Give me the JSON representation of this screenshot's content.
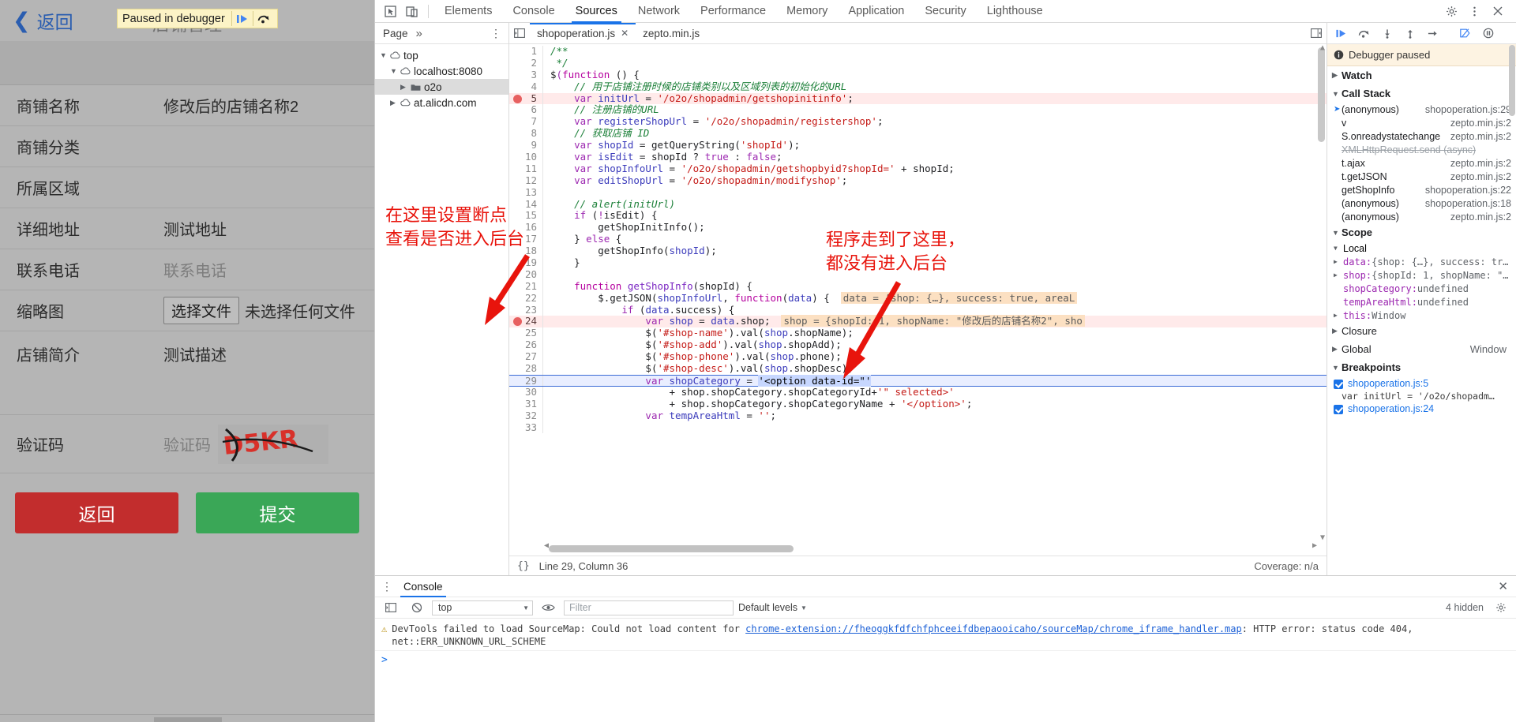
{
  "mobile_page": {
    "back_label": "返回",
    "ghost_title": "店铺管理",
    "paused_banner": {
      "text": "Paused in debugger",
      "resume_icon": "resume-script-icon",
      "step-over_icon": "step-over-icon"
    },
    "fields": [
      {
        "label": "商铺名称",
        "value": "修改后的店铺名称2",
        "placeholder": ""
      },
      {
        "label": "商铺分类",
        "value": "",
        "placeholder": ""
      },
      {
        "label": "所属区域",
        "value": "",
        "placeholder": ""
      },
      {
        "label": "详细地址",
        "value": "测试地址",
        "placeholder": ""
      },
      {
        "label": "联系电话",
        "value": "",
        "placeholder": "联系电话"
      }
    ],
    "thumbnail": {
      "label": "缩略图",
      "button": "选择文件",
      "status": "未选择任何文件"
    },
    "intro": {
      "label": "店铺简介",
      "value": "测试描述"
    },
    "captcha": {
      "label": "验证码",
      "placeholder": "验证码",
      "image_text": "D5KR"
    },
    "buttons": {
      "back": "返回",
      "submit": "提交"
    }
  },
  "devtools": {
    "tabs": [
      "Elements",
      "Console",
      "Sources",
      "Network",
      "Performance",
      "Memory",
      "Application",
      "Security",
      "Lighthouse"
    ],
    "active_tab": "Sources",
    "toolbar_icons": [
      "inspect-element-icon",
      "device-toolbar-icon"
    ],
    "toolbar_right_icons": [
      "settings-gear-icon",
      "more-vertical-icon",
      "close-devtools-icon"
    ],
    "nav": {
      "header_title": "Page",
      "header_more": "»",
      "header_dots": "⋮",
      "tree": [
        {
          "label": "top",
          "depth": 0,
          "icon": "triangle-down",
          "selected": false
        },
        {
          "label": "localhost:8080",
          "depth": 1,
          "icon": "cloud-icon",
          "selected": false
        },
        {
          "label": "o2o",
          "depth": 2,
          "icon": "folder-icon",
          "selected": true
        },
        {
          "label": "at.alicdn.com",
          "depth": 1,
          "icon": "cloud-icon",
          "selected": false
        }
      ]
    },
    "file_tabs": [
      {
        "label": "shopoperation.js",
        "active": true,
        "closable": true
      },
      {
        "label": "zepto.min.js",
        "active": false,
        "closable": false
      }
    ],
    "code_lines": [
      {
        "n": 1,
        "indent": 0,
        "tokens": [
          [
            "com",
            "/**"
          ]
        ]
      },
      {
        "n": 2,
        "indent": 0,
        "tokens": [
          [
            "com",
            " */"
          ]
        ]
      },
      {
        "n": 3,
        "indent": 0,
        "tokens": [
          [
            "pln",
            "$"
          ],
          [
            "kw",
            "("
          ],
          [
            "kw2",
            "function"
          ],
          [
            "pln",
            " () {"
          ]
        ]
      },
      {
        "n": 4,
        "indent": 1,
        "tokens": [
          [
            "com",
            "// 用于店铺注册时候的店铺类别以及区域列表的初始化的URL"
          ]
        ]
      },
      {
        "n": 5,
        "indent": 1,
        "breakpoint": true,
        "tokens": [
          [
            "kw",
            "var"
          ],
          [
            "pln",
            " "
          ],
          [
            "var",
            "initUrl"
          ],
          [
            "pln",
            " = "
          ],
          [
            "str",
            "'/o2o/shopadmin/getshopinitinfo'"
          ],
          [
            "pln",
            ";"
          ]
        ]
      },
      {
        "n": 6,
        "indent": 1,
        "tokens": [
          [
            "com",
            "// 注册店铺的URL"
          ]
        ]
      },
      {
        "n": 7,
        "indent": 1,
        "tokens": [
          [
            "kw",
            "var"
          ],
          [
            "pln",
            " "
          ],
          [
            "var",
            "registerShopUrl"
          ],
          [
            "pln",
            " = "
          ],
          [
            "str",
            "'/o2o/shopadmin/registershop'"
          ],
          [
            "pln",
            ";"
          ]
        ]
      },
      {
        "n": 8,
        "indent": 1,
        "tokens": [
          [
            "com",
            "// 获取店铺 ID"
          ]
        ]
      },
      {
        "n": 9,
        "indent": 1,
        "tokens": [
          [
            "kw",
            "var"
          ],
          [
            "pln",
            " "
          ],
          [
            "var",
            "shopId"
          ],
          [
            "pln",
            " = getQueryString("
          ],
          [
            "str",
            "'shopId'"
          ],
          [
            "pln",
            ");"
          ]
        ]
      },
      {
        "n": 10,
        "indent": 1,
        "tokens": [
          [
            "kw",
            "var"
          ],
          [
            "pln",
            " "
          ],
          [
            "var",
            "isEdit"
          ],
          [
            "pln",
            " = shopId ? "
          ],
          [
            "kw",
            "true"
          ],
          [
            "pln",
            " : "
          ],
          [
            "kw",
            "false"
          ],
          [
            "pln",
            ";"
          ]
        ]
      },
      {
        "n": 11,
        "indent": 1,
        "tokens": [
          [
            "kw",
            "var"
          ],
          [
            "pln",
            " "
          ],
          [
            "var",
            "shopInfoUrl"
          ],
          [
            "pln",
            " = "
          ],
          [
            "str",
            "'/o2o/shopadmin/getshopbyid?shopId='"
          ],
          [
            "pln",
            " + shopId;"
          ]
        ]
      },
      {
        "n": 12,
        "indent": 1,
        "tokens": [
          [
            "kw",
            "var"
          ],
          [
            "pln",
            " "
          ],
          [
            "var",
            "editShopUrl"
          ],
          [
            "pln",
            " = "
          ],
          [
            "str",
            "'/o2o/shopadmin/modifyshop'"
          ],
          [
            "pln",
            ";"
          ]
        ]
      },
      {
        "n": 13,
        "indent": 0,
        "tokens": [
          [
            "pln",
            ""
          ]
        ]
      },
      {
        "n": 14,
        "indent": 1,
        "tokens": [
          [
            "com",
            "// alert(initUrl)"
          ]
        ]
      },
      {
        "n": 15,
        "indent": 1,
        "tokens": [
          [
            "kw",
            "if"
          ],
          [
            "pln",
            " ("
          ],
          [
            "kw",
            "!"
          ],
          [
            "pln",
            "isEdit) {"
          ]
        ]
      },
      {
        "n": 16,
        "indent": 2,
        "tokens": [
          [
            "pln",
            "getShopInitInfo();"
          ]
        ]
      },
      {
        "n": 17,
        "indent": 1,
        "tokens": [
          [
            "pln",
            "} "
          ],
          [
            "kw",
            "else"
          ],
          [
            "pln",
            " {"
          ]
        ]
      },
      {
        "n": 18,
        "indent": 2,
        "tokens": [
          [
            "pln",
            "getShopInfo("
          ],
          [
            "var",
            "shopId"
          ],
          [
            "pln",
            ");"
          ]
        ]
      },
      {
        "n": 19,
        "indent": 1,
        "tokens": [
          [
            "pln",
            "}"
          ]
        ]
      },
      {
        "n": 20,
        "indent": 0,
        "tokens": [
          [
            "pln",
            ""
          ]
        ]
      },
      {
        "n": 21,
        "indent": 1,
        "tokens": [
          [
            "kw2",
            "function"
          ],
          [
            "pln",
            " "
          ],
          [
            "fn",
            "getShopInfo"
          ],
          [
            "pln",
            "(shopId) {"
          ]
        ]
      },
      {
        "n": 22,
        "indent": 2,
        "tokens": [
          [
            "pln",
            "$.getJSON("
          ],
          [
            "var",
            "shopInfoUrl"
          ],
          [
            "pln",
            ", "
          ],
          [
            "kw2",
            "function"
          ],
          [
            "pln",
            "("
          ],
          [
            "var",
            "data"
          ],
          [
            "pln",
            ") {"
          ]
        ],
        "inline_hint": "data = {shop: {…}, success: true, areaL"
      },
      {
        "n": 23,
        "indent": 3,
        "tokens": [
          [
            "kw",
            "if"
          ],
          [
            "pln",
            " ("
          ],
          [
            "var",
            "data"
          ],
          [
            "pln",
            ".success) {"
          ]
        ]
      },
      {
        "n": 24,
        "indent": 4,
        "breakpoint": true,
        "tokens": [
          [
            "kw",
            "var"
          ],
          [
            "pln",
            " "
          ],
          [
            "var",
            "shop"
          ],
          [
            "pln",
            " = "
          ],
          [
            "var",
            "data"
          ],
          [
            "pln",
            ".shop;"
          ]
        ],
        "inline_hint": "shop = {shopId: 1, shopName: \"修改后的店铺名称2\", sho"
      },
      {
        "n": 25,
        "indent": 4,
        "tokens": [
          [
            "pln",
            "$("
          ],
          [
            "str",
            "'#shop-name'"
          ],
          [
            "pln",
            ").val("
          ],
          [
            "var",
            "shop"
          ],
          [
            "pln",
            ".shopName);"
          ]
        ]
      },
      {
        "n": 26,
        "indent": 4,
        "tokens": [
          [
            "pln",
            "$("
          ],
          [
            "str",
            "'#shop-add'"
          ],
          [
            "pln",
            ").val("
          ],
          [
            "var",
            "shop"
          ],
          [
            "pln",
            ".shopAdd);"
          ]
        ]
      },
      {
        "n": 27,
        "indent": 4,
        "tokens": [
          [
            "pln",
            "$("
          ],
          [
            "str",
            "'#shop-phone'"
          ],
          [
            "pln",
            ").val("
          ],
          [
            "var",
            "shop"
          ],
          [
            "pln",
            ".phone);"
          ]
        ]
      },
      {
        "n": 28,
        "indent": 4,
        "tokens": [
          [
            "pln",
            "$("
          ],
          [
            "str",
            "'#shop-desc'"
          ],
          [
            "pln",
            ").val("
          ],
          [
            "var",
            "shop"
          ],
          [
            "pln",
            ".shopDesc);"
          ]
        ]
      },
      {
        "n": 29,
        "indent": 4,
        "executing": true,
        "tokens": [
          [
            "kw",
            "var"
          ],
          [
            "pln",
            " "
          ],
          [
            "var",
            "shopCategory"
          ],
          [
            "pln",
            " = "
          ],
          [
            "sel-tok",
            "'<option data-id=\"'"
          ]
        ]
      },
      {
        "n": 30,
        "indent": 5,
        "tokens": [
          [
            "pln",
            "+ shop.shopCategory.shopCategoryId+"
          ],
          [
            "str",
            "'\" selected>'"
          ]
        ]
      },
      {
        "n": 31,
        "indent": 5,
        "tokens": [
          [
            "pln",
            "+ shop.shopCategory.shopCategoryName + "
          ],
          [
            "str",
            "'</option>'"
          ],
          [
            "pln",
            ";"
          ]
        ]
      },
      {
        "n": 32,
        "indent": 4,
        "tokens": [
          [
            "kw",
            "var"
          ],
          [
            "pln",
            " "
          ],
          [
            "var",
            "tempAreaHtml"
          ],
          [
            "pln",
            " = "
          ],
          [
            "str",
            "''"
          ],
          [
            "pln",
            ";"
          ]
        ]
      },
      {
        "n": 33,
        "indent": 0,
        "tokens": [
          [
            "pln",
            ""
          ]
        ]
      }
    ],
    "status_bar": {
      "braces": "{}",
      "position": "Line 29, Column 36",
      "coverage": "Coverage: n/a"
    },
    "debugger": {
      "toolbar_icons": [
        "resume-icon",
        "step-over-icon",
        "step-into-icon",
        "step-out-icon",
        "step-icon",
        "deactivate-breakpoints-icon",
        "pause-on-exceptions-icon"
      ],
      "banner": "Debugger paused",
      "banner_icon": "info-icon",
      "watch_title": "Watch",
      "call_stack_title": "Call Stack",
      "call_stack": [
        {
          "name": "(anonymous)",
          "loc": "shopoperation.js:29",
          "current": true,
          "async": false
        },
        {
          "name": "v",
          "loc": "zepto.min.js:2",
          "current": false,
          "async": false
        },
        {
          "name": "S.onreadystatechange",
          "loc": "zepto.min.js:2",
          "current": false,
          "async": false
        },
        {
          "name": "XMLHttpRequest.send (async)",
          "loc": "",
          "current": false,
          "async": true
        },
        {
          "name": "t.ajax",
          "loc": "zepto.min.js:2",
          "current": false,
          "async": false
        },
        {
          "name": "t.getJSON",
          "loc": "zepto.min.js:2",
          "current": false,
          "async": false
        },
        {
          "name": "getShopInfo",
          "loc": "shopoperation.js:22",
          "current": false,
          "async": false
        },
        {
          "name": "(anonymous)",
          "loc": "shopoperation.js:18",
          "current": false,
          "async": false
        },
        {
          "name": "(anonymous)",
          "loc": "zepto.min.js:2",
          "current": false,
          "async": false
        }
      ],
      "scope_title": "Scope",
      "scope": [
        {
          "text": "Local",
          "type": "group"
        },
        {
          "key": "data:",
          "val": " {shop: {…}, success: tr…",
          "expandable": true
        },
        {
          "key": "shop:",
          "val": " {shopId: 1, shopName: \"…",
          "expandable": true
        },
        {
          "key": "shopCategory:",
          "val": " undefined",
          "expandable": false
        },
        {
          "key": "tempAreaHtml:",
          "val": " undefined",
          "expandable": false
        },
        {
          "key": "this:",
          "val": " Window",
          "expandable": true
        }
      ],
      "closure_title": "Closure",
      "global_title": "Global",
      "global_value": "Window",
      "breakpoints_title": "Breakpoints",
      "breakpoints": [
        {
          "file": "shopoperation.js:5",
          "code": "var initUrl = '/o2o/shopadm…",
          "checked": true
        },
        {
          "file": "shopoperation.js:24",
          "code": "",
          "checked": true
        }
      ]
    },
    "drawer": {
      "dots": "⋮",
      "tab": "Console",
      "close_icon": "close-drawer-icon",
      "context": "top",
      "filter_placeholder": "Filter",
      "levels": "Default levels",
      "hidden_count": "4 hidden",
      "settings_icon": "console-settings-icon",
      "eye_icon": "live-expression-icon",
      "clear_icon": "clear-console-icon",
      "sidebar_icon": "console-sidebar-icon",
      "message": {
        "prefix": "DevTools failed to load SourceMap: Could not load content for ",
        "link": "chrome-extension://fheoggkfdfchfphceeifdbepaooicaho/sourceMap/chrome_iframe_handler.map",
        "suffix": ": HTTP error: status code 404, net::ERR_UNKNOWN_URL_SCHEME"
      },
      "prompt": ">"
    }
  },
  "annotations": [
    {
      "id": "left-note",
      "text": "在这里设置断点\n查看是否进入后台"
    },
    {
      "id": "right-note",
      "text": "程序走到了这里，\n都没有进入后台"
    }
  ]
}
